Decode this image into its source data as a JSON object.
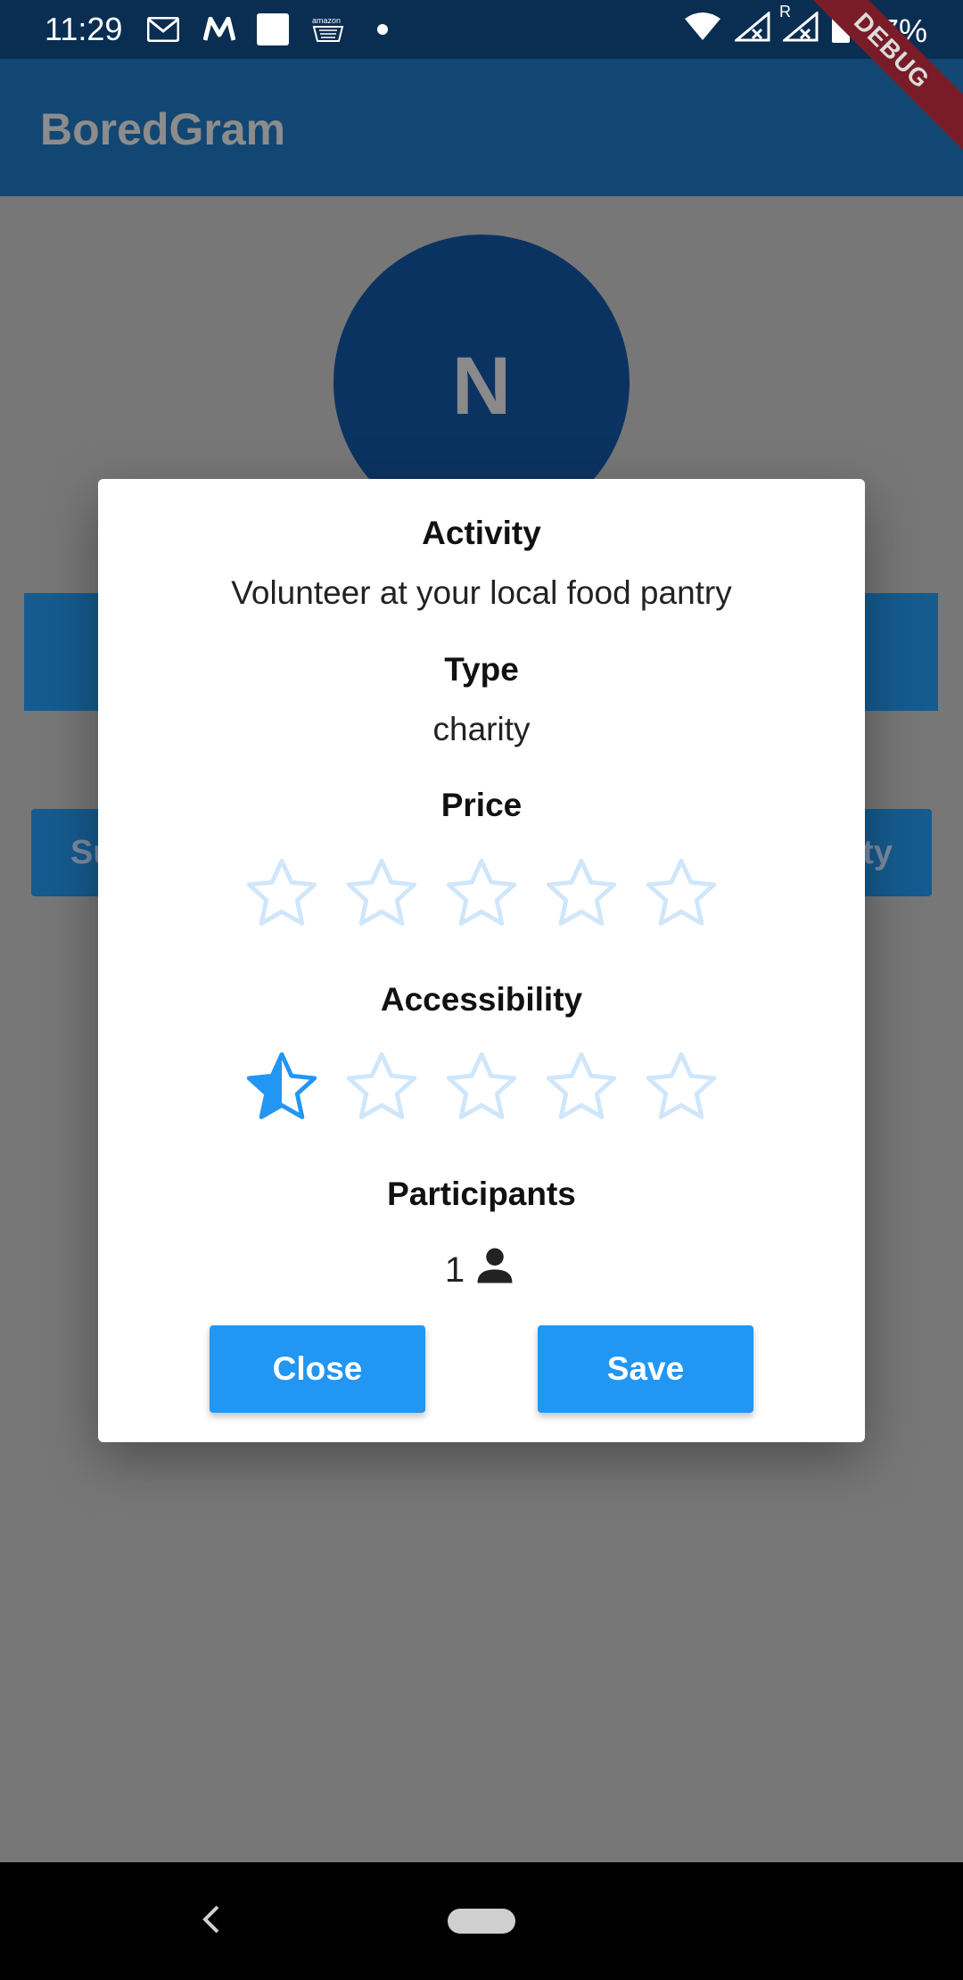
{
  "status_bar": {
    "time": "11:29",
    "battery": "97%",
    "notification_icons": [
      "gmail-icon",
      "myntra-icon",
      "square-icon",
      "amazon-icon",
      "dot-icon"
    ],
    "network_label": "R"
  },
  "app_bar": {
    "title": "BoredGram"
  },
  "debug_banner": "DEBUG",
  "background": {
    "avatar_initial": "N",
    "left_button_partial": "Su",
    "right_button_partial": "ty"
  },
  "dialog": {
    "activity_heading": "Activity",
    "activity_value": "Volunteer at your local food pantry",
    "type_heading": "Type",
    "type_value": "charity",
    "price_heading": "Price",
    "price_rating": 0,
    "accessibility_heading": "Accessibility",
    "accessibility_rating": 0.5,
    "max_rating": 5,
    "participants_heading": "Participants",
    "participants_value": "1",
    "close_label": "Close",
    "save_label": "Save"
  },
  "colors": {
    "accent": "#2196f3",
    "star_empty": "#cfe6fb",
    "app_bar": "#134773",
    "scrim": "#777777"
  }
}
